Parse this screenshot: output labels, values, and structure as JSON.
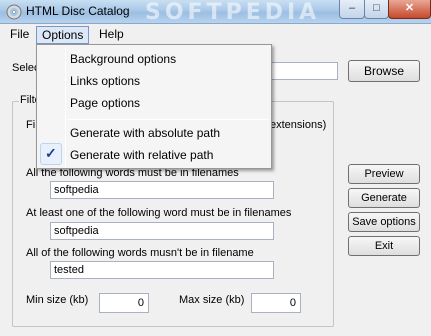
{
  "window": {
    "title": "HTML Disc Catalog",
    "watermark": "SOFTPEDIA",
    "controls": {
      "minimize": "–",
      "maximize": "□",
      "close": "✕"
    }
  },
  "menubar": {
    "file": "File",
    "options": "Options",
    "help": "Help"
  },
  "options_menu": {
    "items": [
      "Background options",
      "Links options",
      "Page options"
    ],
    "path_items": [
      "Generate with absolute path",
      "Generate with relative path"
    ],
    "checked": "Generate with relative path"
  },
  "select": {
    "label_fragment": "Selec",
    "path_value": ""
  },
  "filters": {
    "group_title_fragment": "Filte",
    "left_fragment": "Fi",
    "right_fragment": "extensions)",
    "all_words_label": "All the following words must be in filenames",
    "all_words_value": "softpedia",
    "one_word_label": "At least one of the following word must be in filenames",
    "one_word_value": "softpedia",
    "none_words_label": "All of the following words musn't be in filename",
    "none_words_value": "tested",
    "min_size_label": "Min size (kb)",
    "min_size_value": "0",
    "max_size_label": "Max size (kb)",
    "max_size_value": "0"
  },
  "buttons": {
    "browse": "Browse",
    "preview": "Preview",
    "generate": "Generate",
    "save_options": "Save options",
    "exit": "Exit"
  },
  "colors": {
    "menu_highlight": "#dce8f6",
    "check": "#1c3f94",
    "close_button": "#c7492c"
  }
}
